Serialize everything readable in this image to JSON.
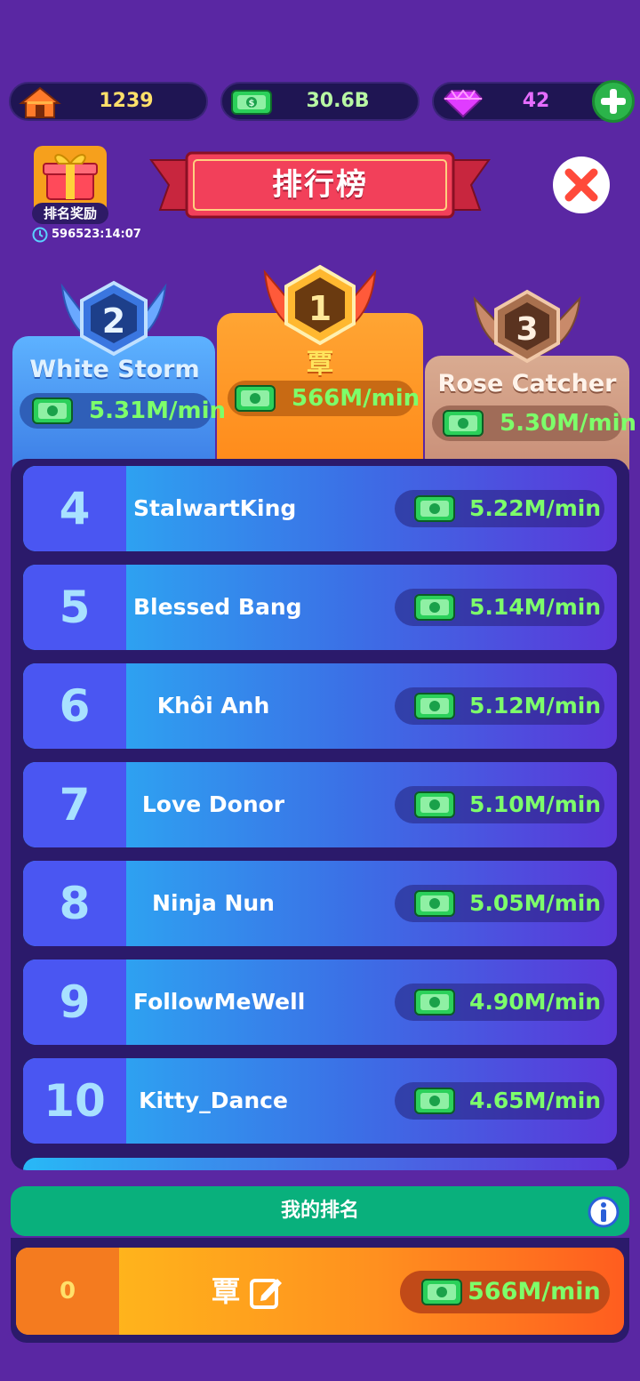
{
  "currency": {
    "home": "1239",
    "cash": "30.6B",
    "gems": "42"
  },
  "header": {
    "reward_label": "排名奖励",
    "reward_timer": "596523:14:07",
    "title": "排行榜"
  },
  "podium": {
    "first": {
      "rank": "1",
      "name": "覃",
      "value": "566M/min"
    },
    "second": {
      "rank": "2",
      "name": "White Storm",
      "value": "5.31M/min"
    },
    "third": {
      "rank": "3",
      "name": "Rose Catcher",
      "value": "5.30M/min"
    }
  },
  "rows": [
    {
      "rank": "4",
      "name": "StalwartKing",
      "value": "5.22M/min"
    },
    {
      "rank": "5",
      "name": "Blessed Bang",
      "value": "5.14M/min"
    },
    {
      "rank": "6",
      "name": "Khôi Anh",
      "value": "5.12M/min"
    },
    {
      "rank": "7",
      "name": "Love Donor",
      "value": "5.10M/min"
    },
    {
      "rank": "8",
      "name": "Ninja Nun",
      "value": "5.05M/min"
    },
    {
      "rank": "9",
      "name": "FollowMeWell",
      "value": "4.90M/min"
    },
    {
      "rank": "10",
      "name": "Kitty_Dance",
      "value": "4.65M/min"
    }
  ],
  "my_rank": {
    "header": "我的排名",
    "rank": "0",
    "name": "覃",
    "value": "566M/min"
  },
  "colors": {
    "background": "#5a27a3",
    "money_green": "#7dff6a",
    "gold": "#ffe06a",
    "gem_pink": "#e56cff"
  }
}
